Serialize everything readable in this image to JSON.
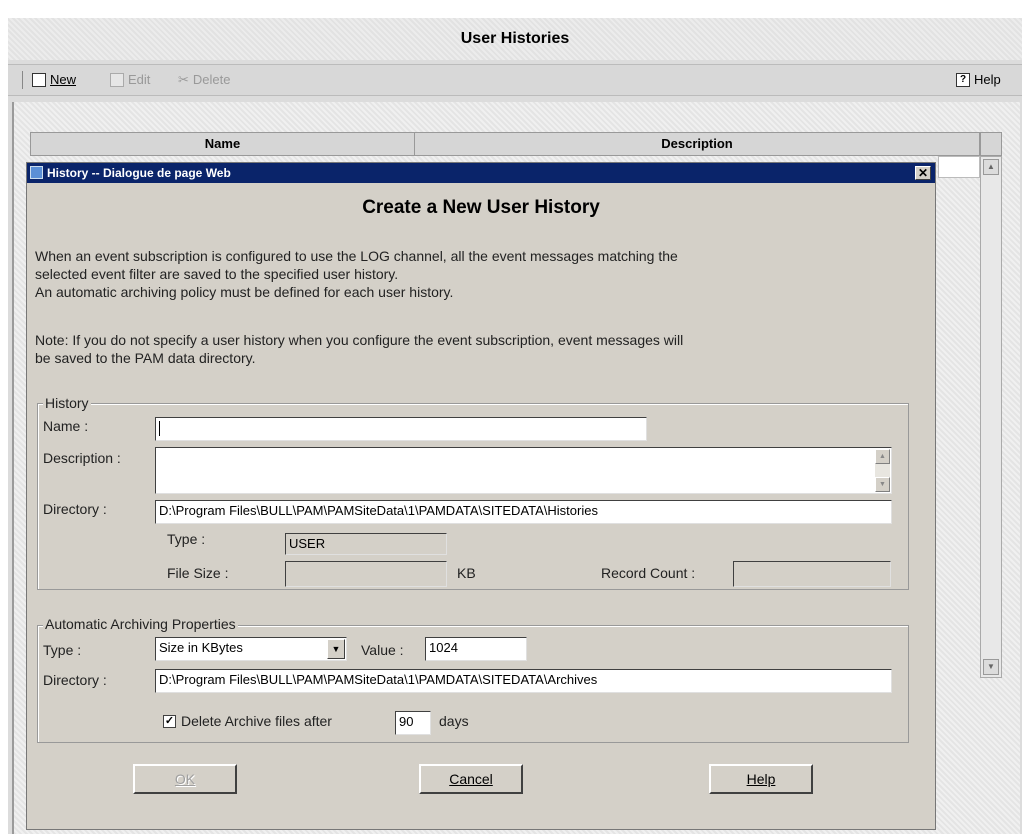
{
  "app": {
    "title": "User Histories"
  },
  "toolbar": {
    "new_label": "New",
    "edit_label": "Edit",
    "delete_label": "Delete",
    "help_label": "Help"
  },
  "grid": {
    "columns": [
      "Name",
      "Description"
    ]
  },
  "dialog": {
    "window_title": "History -- Dialogue de page Web",
    "heading": "Create a New User History",
    "intro_line1": "When an event subscription is configured to use the LOG channel, all the event messages matching the",
    "intro_line2": "selected event filter are saved to the specified user history.",
    "intro_line3": "An automatic archiving policy must be defined for each user history.",
    "note_line1": "Note: If you do not specify a user history when you configure the event subscription, event messages will",
    "note_line2": "be saved to the PAM data directory.",
    "history": {
      "legend": "History",
      "name_label": "Name :",
      "name_value": "",
      "description_label": "Description :",
      "description_value": "",
      "directory_label": "Directory :",
      "directory_value": "D:\\Program Files\\BULL\\PAM\\PAMSiteData\\1\\PAMDATA\\SITEDATA\\Histories",
      "type_label": "Type :",
      "type_value": "USER",
      "file_size_label": "File Size :",
      "file_size_value": "",
      "file_size_unit": "KB",
      "record_count_label": "Record Count :",
      "record_count_value": ""
    },
    "archiving": {
      "legend": "Automatic Archiving Properties",
      "type_label": "Type :",
      "type_selected": "Size in KBytes",
      "value_label": "Value :",
      "value": "1024",
      "directory_label": "Directory :",
      "directory_value": "D:\\Program Files\\BULL\\PAM\\PAMSiteData\\1\\PAMDATA\\SITEDATA\\Archives",
      "delete_checked": true,
      "delete_label": "Delete Archive files after",
      "delete_days": "90",
      "days_label": "days"
    },
    "buttons": {
      "ok": "OK",
      "cancel": "Cancel",
      "help": "Help"
    }
  }
}
